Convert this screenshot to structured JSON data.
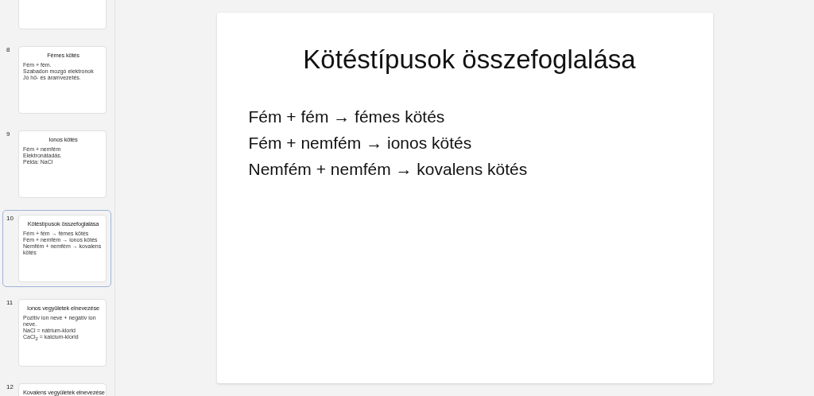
{
  "slides": [
    {
      "cut_off": true,
      "selected": false
    },
    {
      "number": "8",
      "title": "Fémes kötés",
      "lines": [
        "Fém + fém.",
        "Szabadon mozgó elektronok",
        "Jó hő- és áramvezetés."
      ],
      "selected": false
    },
    {
      "number": "9",
      "title": "Ionos kötés",
      "lines": [
        "Fém + nemfém",
        "Elektronátadás.",
        "Példa: NaCl"
      ],
      "selected": false
    },
    {
      "number": "10",
      "title": "Kötéstípusok összefoglalása",
      "lines": [
        "Fém + fém → fémes kötés",
        "Fém + nemfém → ionos kötés",
        "Nemfém + nemfém → kovalens kötés"
      ],
      "selected": true
    },
    {
      "number": "11",
      "title": "Ionos vegyületek elnevezése",
      "lines": [
        "Pozitív ion neve + negatív ion neve.",
        "NaCl = nátrium-klorid",
        "CaCl$_{2}$ = kalcium-klorid"
      ],
      "selected": false
    },
    {
      "number": "12",
      "title": "Kovalens vegyületek elnevezése",
      "selected": false
    }
  ],
  "current_slide": {
    "title": "Kötéstípusok összefoglalása",
    "lines": [
      "Fém + fém → fémes kötés",
      "Fém + nemfém → ionos kötés",
      "Nemfém + nemfém → kovalens kötés"
    ]
  }
}
